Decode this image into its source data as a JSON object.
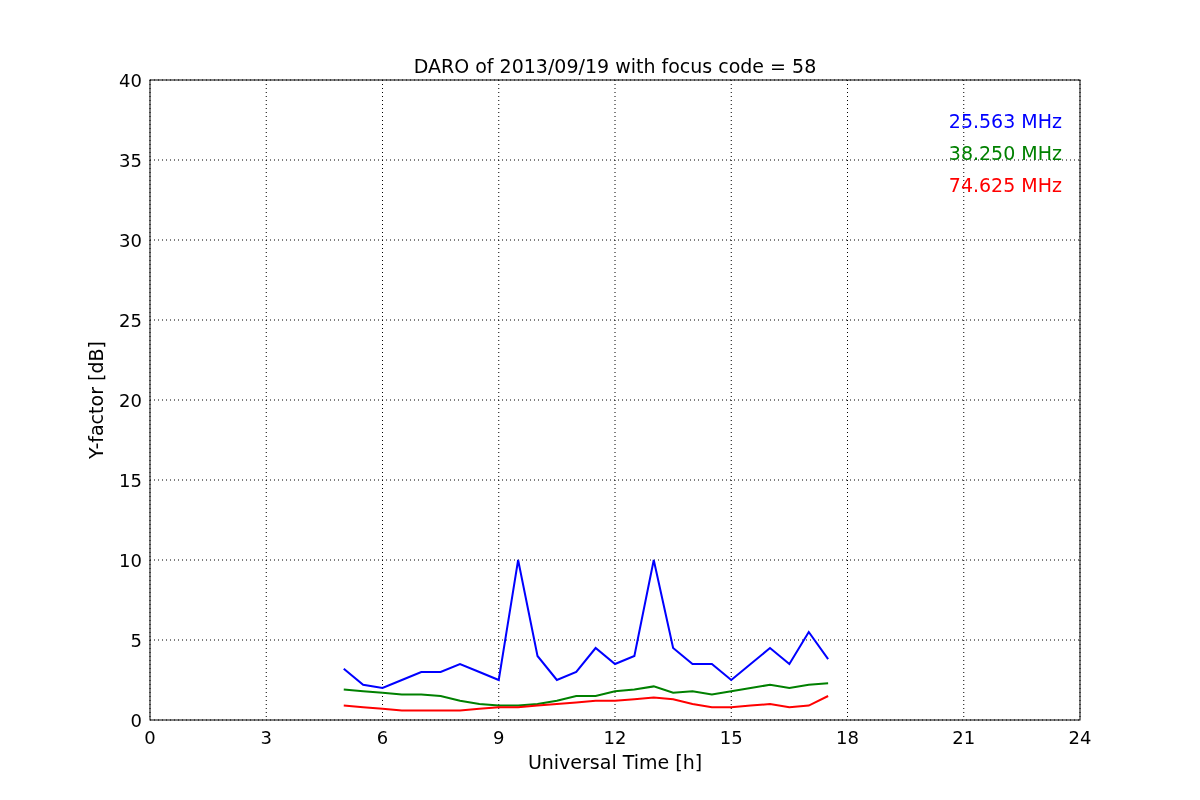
{
  "chart_data": {
    "type": "line",
    "title": "DARO of 2013/09/19 with focus code = 58",
    "xlabel": "Universal Time [h]",
    "ylabel": "Y-factor [dB]",
    "x": [
      5,
      5.5,
      6,
      6.5,
      7,
      7.5,
      8,
      8.5,
      9,
      9.5,
      10,
      10.5,
      11,
      11.5,
      12,
      12.5,
      13,
      13.5,
      14,
      14.5,
      15,
      15.5,
      16,
      16.5,
      17,
      17.5
    ],
    "series": [
      {
        "name": "25.563 MHz",
        "color": "#0000ff",
        "values": [
          3.2,
          2.2,
          2.0,
          2.5,
          3.0,
          3.0,
          3.5,
          3.0,
          2.5,
          10,
          4,
          2.5,
          3,
          4.5,
          3.5,
          4,
          10,
          4.5,
          3.5,
          3.5,
          2.5,
          3.5,
          4.5,
          3.5,
          5.5,
          3.8
        ]
      },
      {
        "name": "38.250 MHz",
        "color": "#008000",
        "values": [
          1.9,
          1.8,
          1.7,
          1.6,
          1.6,
          1.5,
          1.2,
          1.0,
          0.9,
          0.9,
          1.0,
          1.2,
          1.5,
          1.5,
          1.8,
          1.9,
          2.1,
          1.7,
          1.8,
          1.6,
          1.8,
          2.0,
          2.2,
          2.0,
          2.2,
          2.3
        ]
      },
      {
        "name": "74.625 MHz",
        "color": "#ff0000",
        "values": [
          0.9,
          0.8,
          0.7,
          0.6,
          0.6,
          0.6,
          0.6,
          0.7,
          0.8,
          0.8,
          0.9,
          1.0,
          1.1,
          1.2,
          1.2,
          1.3,
          1.4,
          1.3,
          1.0,
          0.8,
          0.8,
          0.9,
          1.0,
          0.8,
          0.9,
          1.5
        ]
      }
    ],
    "xlim": [
      0,
      24
    ],
    "ylim": [
      0,
      40
    ],
    "xticks": [
      0,
      3,
      6,
      9,
      12,
      15,
      18,
      21,
      24
    ],
    "yticks": [
      0,
      5,
      10,
      15,
      20,
      25,
      30,
      35,
      40
    ],
    "grid": true
  }
}
